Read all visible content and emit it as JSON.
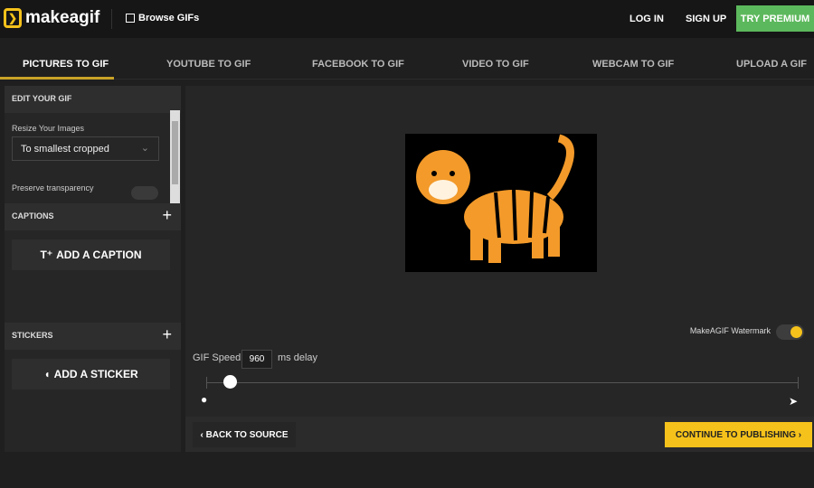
{
  "header": {
    "logo": "makeagif",
    "browse": "Browse GIFs",
    "login": "LOG IN",
    "signup": "SIGN UP",
    "premium": "TRY PREMIUM"
  },
  "tabs": [
    "PICTURES TO GIF",
    "YOUTUBE TO GIF",
    "FACEBOOK TO GIF",
    "VIDEO TO GIF",
    "WEBCAM TO GIF",
    "UPLOAD A GIF"
  ],
  "sidebar": {
    "edit_title": "EDIT YOUR GIF",
    "resize_label": "Resize Your Images",
    "resize_value": "To smallest cropped",
    "transparency_label": "Preserve transparency",
    "transparency_on": false,
    "captions_title": "CAPTIONS",
    "add_caption": "ADD A CAPTION",
    "stickers_title": "STICKERS",
    "add_sticker": "ADD A STICKER"
  },
  "main": {
    "watermark_label": "MakeAGIF Watermark",
    "watermark_on": true,
    "speed_label": "GIF Speed:",
    "speed_value": "960",
    "speed_unit": "ms delay",
    "back": "BACK TO SOURCE",
    "continue": "CONTINUE TO PUBLISHING"
  },
  "colors": {
    "accent": "#f5c21b",
    "premium": "#5cb85c"
  }
}
